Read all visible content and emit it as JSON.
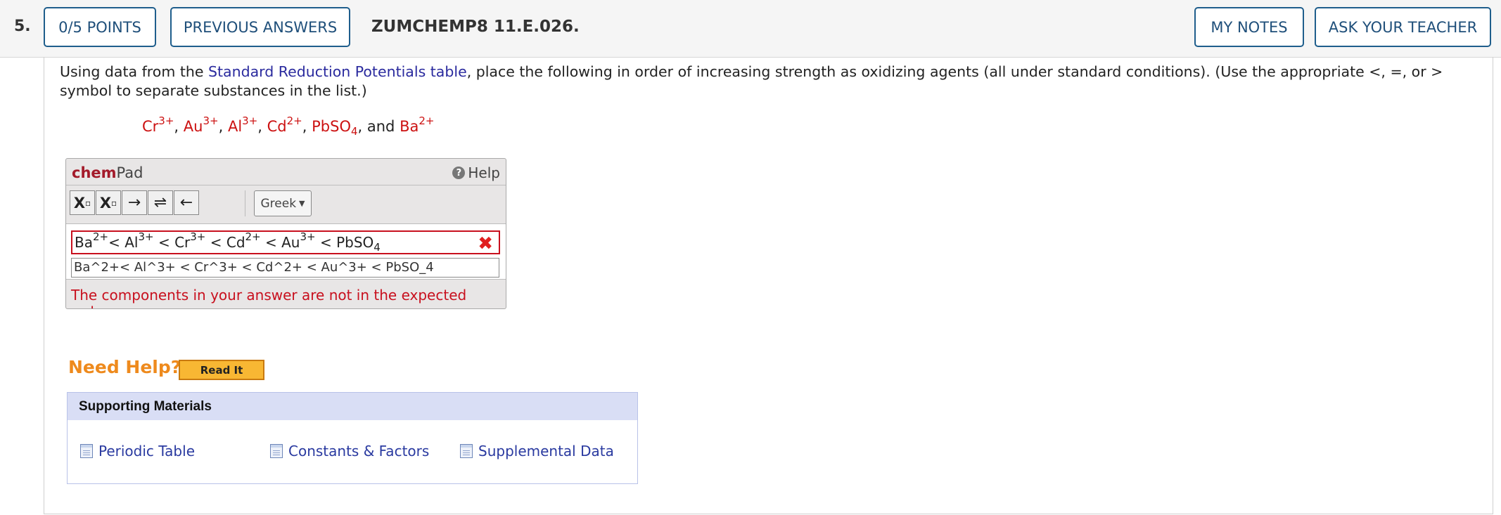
{
  "header": {
    "question_number": "5.",
    "points_label": "0/5 POINTS",
    "previous_answers_label": "PREVIOUS ANSWERS",
    "question_id": "ZUMCHEMP8 11.E.026.",
    "my_notes_label": "MY NOTES",
    "ask_teacher_label": "ASK YOUR TEACHER"
  },
  "question": {
    "text_before_link": "Using data from the ",
    "link_text": "Standard Reduction Potentials table",
    "text_after_link": ", place the following in order of increasing strength as oxidizing agents (all under standard conditions). (Use the appropriate <, =, or > symbol to separate substances in the list.)",
    "species": {
      "cr": "Cr",
      "cr_charge": "3+",
      "au": "Au",
      "au_charge": "3+",
      "al": "Al",
      "al_charge": "3+",
      "cd": "Cd",
      "cd_charge": "2+",
      "pbso": "PbSO",
      "pbso_sub": "4",
      "and_text": ", and",
      "ba": "Ba",
      "ba_charge": "2+"
    }
  },
  "chempad": {
    "title_chem": "chem",
    "title_pad": "Pad",
    "help_label": "Help",
    "toolbar": {
      "subscript": "X",
      "superscript": "X",
      "right_arrow": "→",
      "equilibrium": "⇌",
      "left_arrow": "←",
      "greek_label": "Greek"
    },
    "answer_rendered": {
      "p1": "Ba",
      "c1": "2+",
      "p2": "< Al",
      "c2": "3+",
      "p3": " < Cr",
      "c3": "3+",
      "p4": " < Cd",
      "c4": "2+",
      "p5": " < Au",
      "c5": "3+",
      "p6": " < PbSO",
      "s6": "4"
    },
    "answer_raw": "Ba^2+< Al^3+ < Cr^3+ < Cd^2+ < Au^3+ < PbSO_4",
    "feedback": "The components in your answer are not in the expected order."
  },
  "help": {
    "need_help_label": "Need Help?",
    "read_it_label": "Read It"
  },
  "supporting": {
    "heading": "Supporting Materials",
    "links": [
      "Periodic Table",
      "Constants & Factors",
      "Supplemental Data"
    ]
  },
  "colors": {
    "accent_blue": "#1f5e8c",
    "error_red": "#c8101e",
    "help_orange": "#ee8a1d"
  }
}
